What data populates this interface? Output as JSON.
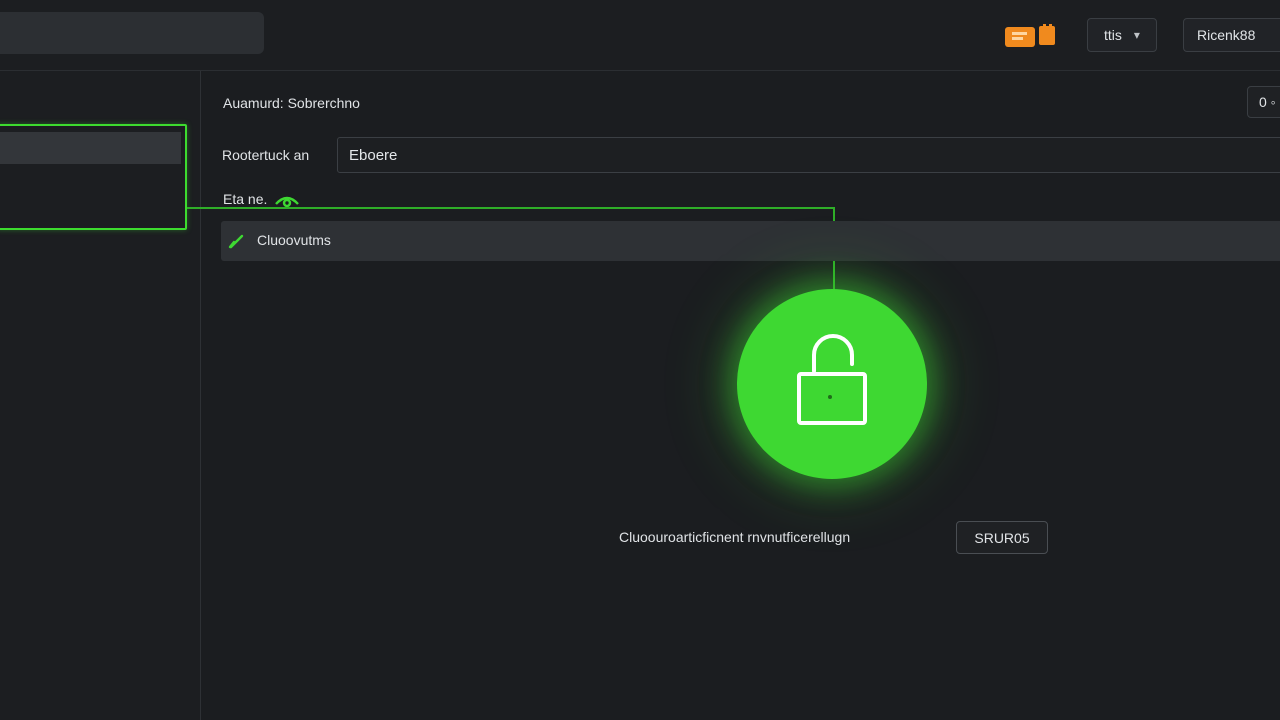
{
  "topbar": {
    "language_label": "ttis",
    "language_chevron": "▾",
    "account_label": "Ricenk88"
  },
  "form": {
    "heading": "Auamurd: Sobrerchno",
    "corner_button_label": "0 ◦",
    "field_label": "Rootertuck an",
    "field_value": "Eboere",
    "status_label": "Eta ne.",
    "status_text": "Cluoovutms"
  },
  "footer": {
    "message": "Cluoouroarticficnent rnvnutficerellugn",
    "button_label": "SRUR05"
  },
  "colors": {
    "accent_green": "#3ed832",
    "icon_orange": "#f08a1e",
    "background": "#1b1d20"
  },
  "icons": {
    "app": "orange-app-icon",
    "eye": "eye-icon",
    "check": "check-icon",
    "lock": "unlock-icon"
  }
}
